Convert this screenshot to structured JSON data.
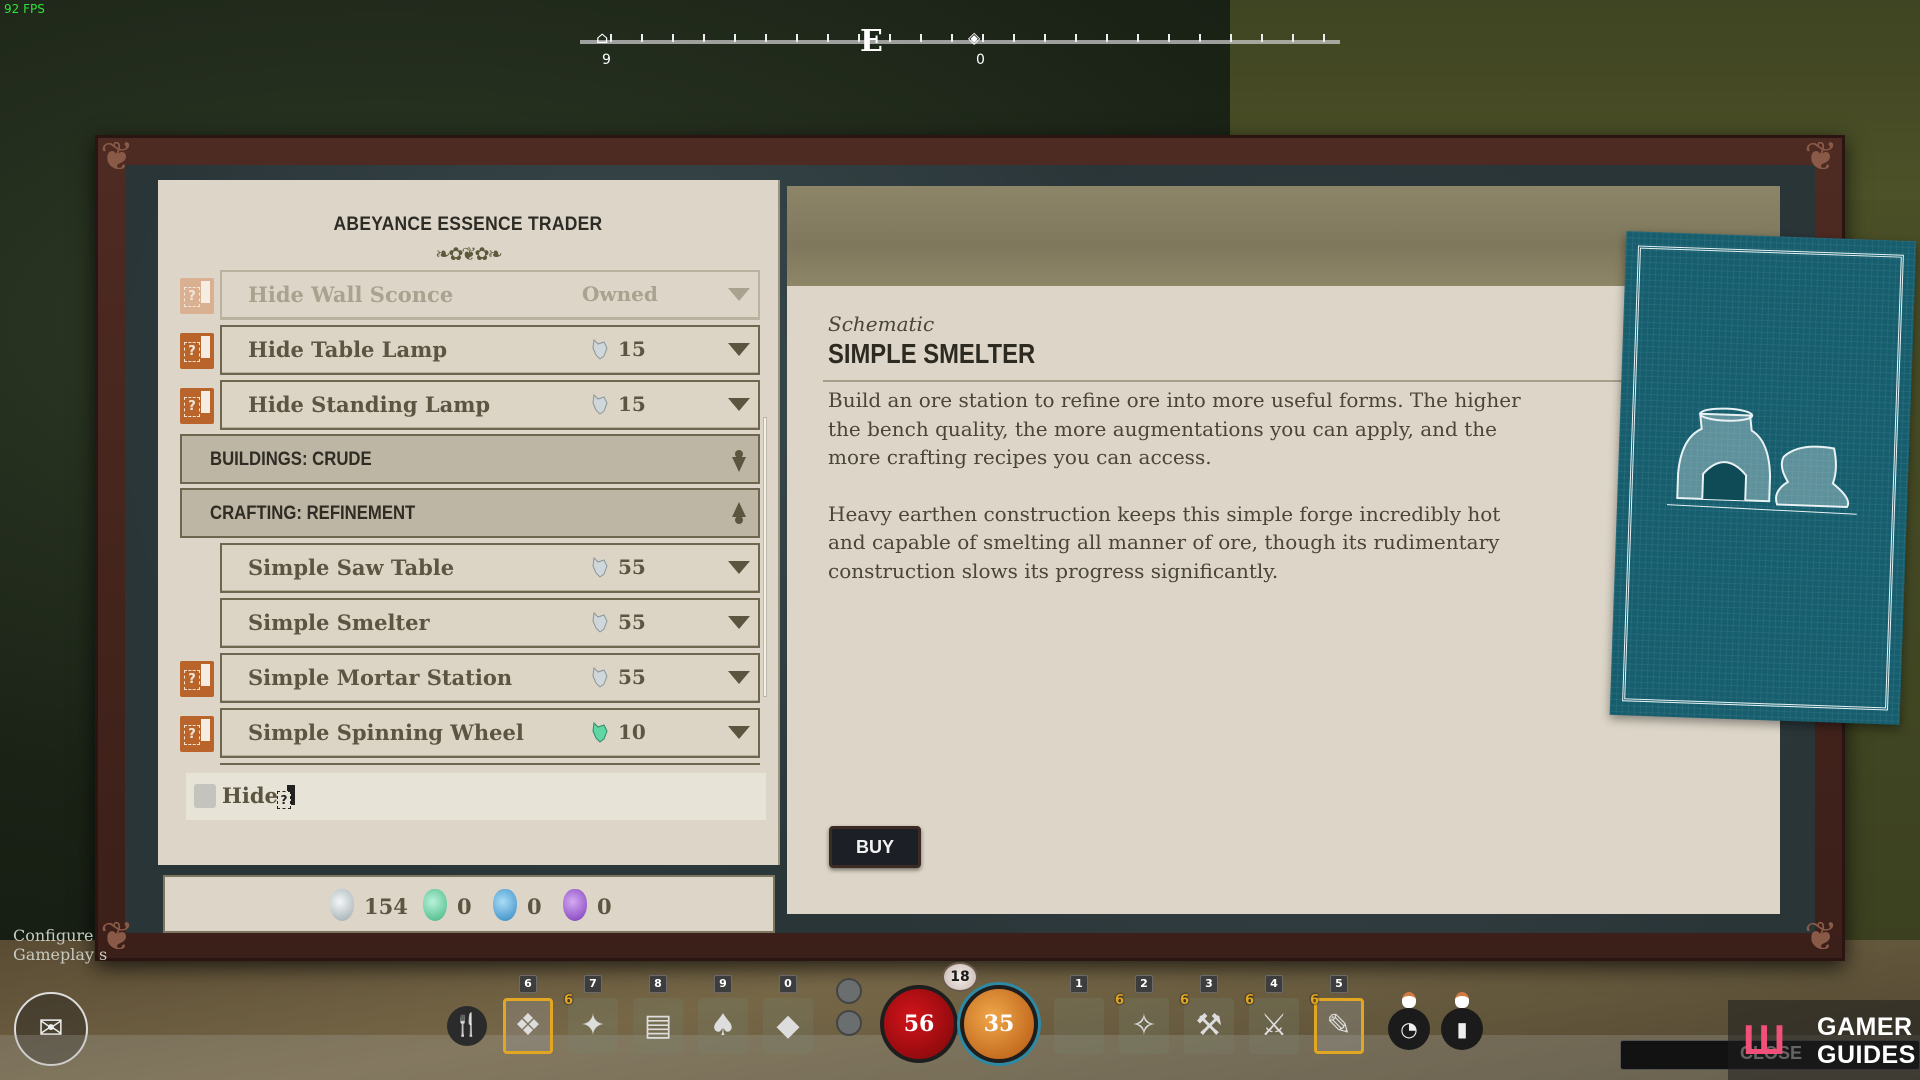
{
  "hud": {
    "fps": "92 FPS",
    "compass": {
      "heading": "E",
      "markers": [
        {
          "icon": "home-icon",
          "value": "9"
        },
        {
          "icon": "waypoint-icon",
          "value": "0"
        }
      ]
    },
    "configure_text": [
      "Configure",
      "Gameplay s"
    ],
    "hotbar_left": [
      {
        "key": "6",
        "selected": true,
        "badge": "",
        "icon": "hide-item-icon"
      },
      {
        "key": "7",
        "selected": false,
        "badge": "6",
        "icon": "torch-icon"
      },
      {
        "key": "8",
        "selected": false,
        "badge": "",
        "icon": "map-icon"
      },
      {
        "key": "9",
        "selected": false,
        "badge": "",
        "icon": "mushroom-icon"
      },
      {
        "key": "0",
        "selected": false,
        "badge": "",
        "icon": "ore-icon"
      }
    ],
    "hotbar_right": [
      {
        "key": "1",
        "selected": false,
        "badge": "",
        "icon": "empty-slot"
      },
      {
        "key": "2",
        "selected": false,
        "badge": "6",
        "icon": "hide-tool-icon"
      },
      {
        "key": "3",
        "selected": false,
        "badge": "6",
        "icon": "pickaxe-icon"
      },
      {
        "key": "4",
        "selected": false,
        "badge": "6",
        "icon": "axe-icon"
      },
      {
        "key": "5",
        "selected": true,
        "badge": "6",
        "icon": "knife-icon"
      }
    ],
    "level": "18",
    "health": "56",
    "stamina": "35",
    "close_label": "CLOSE",
    "watermark": [
      "GAMER",
      "GUIDES"
    ]
  },
  "trader": {
    "title": "ABEYANCE ESSENCE TRADER",
    "list": [
      {
        "type": "item",
        "name": "Hide Wall Sconce",
        "status": "Owned",
        "schematic": true,
        "owned": true
      },
      {
        "type": "item",
        "name": "Hide Table Lamp",
        "price": "15",
        "currency": "white",
        "schematic": true
      },
      {
        "type": "item",
        "name": "Hide Standing Lamp",
        "price": "15",
        "currency": "white",
        "schematic": true
      },
      {
        "type": "category",
        "name": "BUILDINGS: CRUDE",
        "expanded": false
      },
      {
        "type": "category",
        "name": "CRAFTING: REFINEMENT",
        "expanded": true
      },
      {
        "type": "item",
        "name": "Simple Saw Table",
        "price": "55",
        "currency": "white",
        "schematic": false
      },
      {
        "type": "item",
        "name": "Simple Smelter",
        "price": "55",
        "currency": "white",
        "schematic": false,
        "selected": true
      },
      {
        "type": "item",
        "name": "Simple Mortar Station",
        "price": "55",
        "currency": "white",
        "schematic": true
      },
      {
        "type": "item",
        "name": "Simple Spinning Wheel",
        "price": "10",
        "currency": "green",
        "schematic": true
      }
    ],
    "hide_filter": {
      "label": "Hide",
      "checked": false
    },
    "currencies": [
      {
        "name": "white-essence",
        "value": "154",
        "color": "#d6dde0"
      },
      {
        "name": "green-essence",
        "value": "0",
        "color": "#5fd6a4"
      },
      {
        "name": "blue-essence",
        "value": "0",
        "color": "#4aa9e0"
      },
      {
        "name": "purple-essence",
        "value": "0",
        "color": "#9b5ad6"
      }
    ]
  },
  "detail": {
    "type": "Schematic",
    "title": "SIMPLE SMELTER",
    "description": [
      "Build an ore station to refine ore into more useful forms. The higher the bench quality, the more augmentations you can apply, and the more crafting recipes you can access.",
      "Heavy earthen construction keeps this simple forge incredibly hot and capable of smelting all manner of ore, though its rudimentary construction slows its progress significantly."
    ],
    "buy_label": "BUY",
    "image": "smelter-blueprint"
  }
}
